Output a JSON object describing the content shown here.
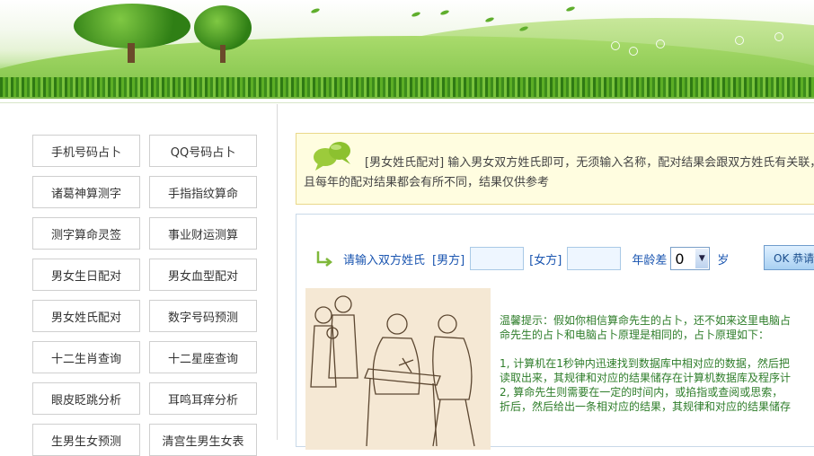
{
  "sidebar": {
    "buttons": [
      "手机号码占卜",
      "QQ号码占卜",
      "诸葛神算测字",
      "手指指纹算命",
      "测字算命灵签",
      "事业财运测算",
      "男女生日配对",
      "男女血型配对",
      "男女姓氏配对",
      "数字号码预测",
      "十二生肖查询",
      "十二星座查询",
      "眼皮眨跳分析",
      "耳鸣耳痒分析",
      "生男生女预测",
      "清宫生男生女表"
    ]
  },
  "notice": {
    "text": "[男女姓氏配对] 输入男女双方姓氏即可，无须输入名称，配对结果会跟双方姓氏有关联，并且每年的配对结果都会有所不同，结果仅供参考"
  },
  "form": {
    "prompt": "请输入双方姓氏",
    "male_label": "[男方]",
    "female_label": "[女方]",
    "age_label": "年龄差",
    "age_value": "0",
    "age_unit": "岁",
    "ok_label": "OK 恭请"
  },
  "tips": {
    "line1": "温馨提示：假如你相信算命先生的占卜，还不如来这里电脑占",
    "line2": "命先生的占卜和电脑占卜原理是相同的，占卜原理如下：",
    "line3": "1, 计算机在1秒钟内迅速找到数据库中相对应的数据，然后把",
    "line4": "读取出来，其规律和对应的结果储存在计算机数据库及程序计",
    "line5": "2, 算命先生则需要在一定的时间内，或掐指或查阅或思索，",
    "line6": "折后，然后给出一条相对应的结果，其规律和对应的结果储存"
  },
  "colors": {
    "accent_blue": "#1a55b0",
    "tip_green": "#2e7d2a",
    "notice_bg": "#fffde0"
  }
}
